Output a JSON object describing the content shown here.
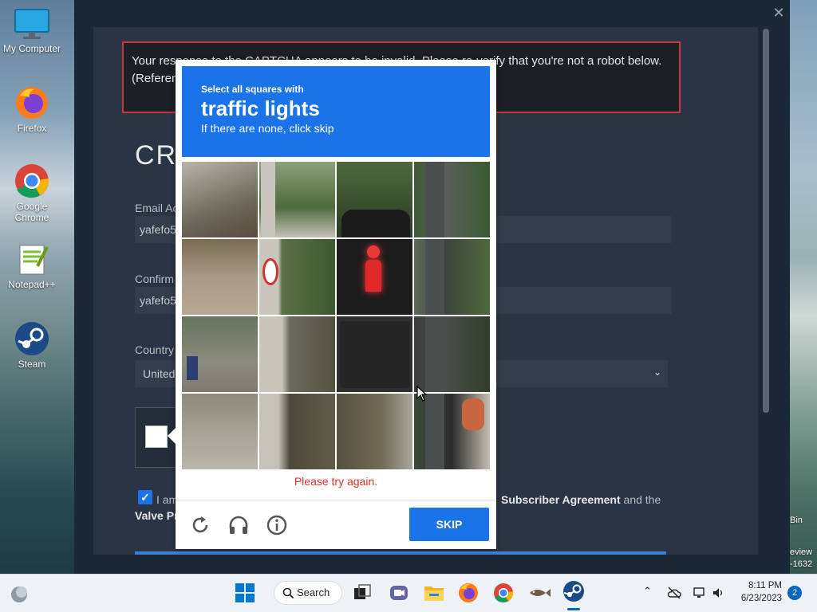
{
  "desktop": {
    "icons": [
      {
        "label": "My Computer",
        "icon": "monitor-icon"
      },
      {
        "label": "Firefox",
        "icon": "firefox-icon"
      },
      {
        "label": "Google Chrome",
        "icon": "chrome-icon"
      },
      {
        "label": "Notepad++",
        "icon": "notepad-plus-plus-icon"
      },
      {
        "label": "Steam",
        "icon": "steam-icon"
      }
    ],
    "right_edge_text": {
      "bin": "Bin",
      "preview": "eview",
      "build": "-1632"
    }
  },
  "window": {
    "close_glyph": "✕",
    "error_message": "Your response to the CAPTCHA appears to be invalid. Please re-verify that you're not a robot below.",
    "error_reference": "(Referen",
    "title_partial": "CR",
    "email_label": "Email Ac",
    "email_value": "yafefo5",
    "confirm_label": "Confirm",
    "confirm_value": "yafefo5",
    "country_label": "Country",
    "country_value": "United",
    "agree_start": "I am",
    "agree_link1": "Subscriber Agreement",
    "agree_and": "and the",
    "agree_line2": "Valve Pr"
  },
  "captcha": {
    "instruction_small": "Select all squares with",
    "target": "traffic lights",
    "hint": "If there are none, click skip",
    "error": "Please try again.",
    "skip_label": "SKIP",
    "tools": [
      "reload-icon",
      "audio-headphones-icon",
      "info-icon"
    ]
  },
  "taskbar": {
    "search_label": "Search",
    "time": "8:11 PM",
    "date": "6/23/2023",
    "notification_count": "2",
    "pinned": [
      "start-icon",
      "search-icon",
      "task-view-icon",
      "chat-icon",
      "file-explorer-icon",
      "firefox-icon",
      "chrome-icon",
      "fish-app-icon",
      "steam-icon"
    ]
  },
  "colors": {
    "accent_blue": "#1a73e8",
    "error_red": "#c5383e",
    "steam_dark": "#1b2838"
  }
}
